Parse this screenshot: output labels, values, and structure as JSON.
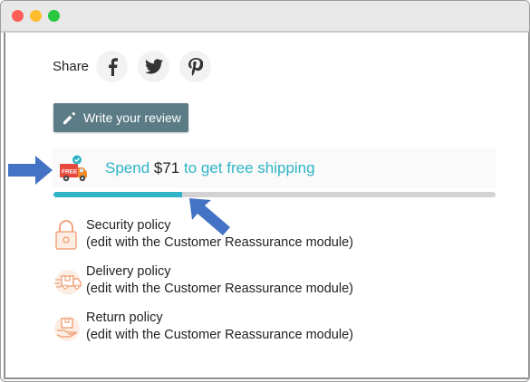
{
  "window": {
    "controls": [
      "close",
      "minimize",
      "maximize"
    ],
    "colors": {
      "close": "#fd5f57",
      "minimize": "#febc2e",
      "maximize": "#28c840"
    }
  },
  "share": {
    "label": "Share",
    "networks": [
      {
        "name": "facebook",
        "icon": "facebook-icon"
      },
      {
        "name": "twitter",
        "icon": "twitter-icon"
      },
      {
        "name": "pinterest",
        "icon": "pinterest-icon"
      }
    ]
  },
  "review_button": {
    "label": "Write your review",
    "icon": "pencil-icon",
    "color": "#5b7c86"
  },
  "free_shipping": {
    "badge": "FREE",
    "prefix": "Spend ",
    "amount": "$71",
    "suffix": " to get free shipping",
    "progress": 0.29,
    "accent": "#2fb4c7"
  },
  "policies": [
    {
      "title": "Security policy",
      "description": "(edit with the Customer Reassurance module)",
      "icon": "security-lock-icon"
    },
    {
      "title": "Delivery policy",
      "description": "(edit with the Customer Reassurance module)",
      "icon": "delivery-truck-icon"
    },
    {
      "title": "Return policy",
      "description": "(edit with the Customer Reassurance module)",
      "icon": "return-box-icon"
    }
  ],
  "annotations": {
    "arrow_color": "#4472c4"
  }
}
